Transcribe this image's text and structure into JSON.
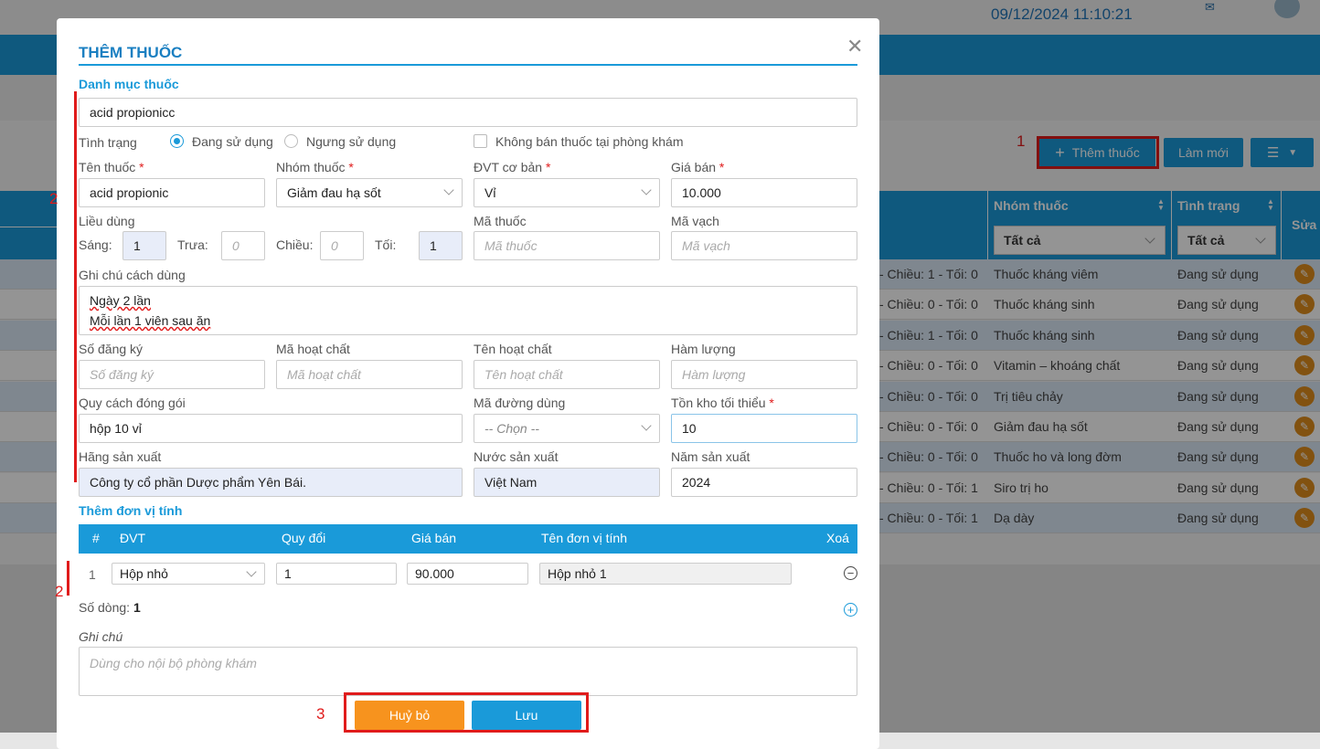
{
  "header": {
    "datetime": "09/12/2024 11:10:21"
  },
  "toolbar": {
    "add_label": "Thêm thuốc",
    "refresh_label": "Làm mới"
  },
  "table": {
    "col_group": "Nhóm thuốc",
    "col_status": "Tình trạng",
    "col_edit": "Sửa",
    "filter_group": "Tất cả",
    "filter_status": "Tất cả",
    "rows": [
      {
        "dose": "- Chiều: 1 - Tối: 0",
        "group": "Thuốc kháng viêm",
        "status": "Đang sử dụng"
      },
      {
        "dose": "- Chiều: 0 - Tối: 0",
        "group": "Thuốc kháng sinh",
        "status": "Đang sử dụng"
      },
      {
        "dose": "- Chiều: 1 - Tối: 0",
        "group": "Thuốc kháng sinh",
        "status": "Đang sử dụng"
      },
      {
        "dose": "- Chiều: 0 - Tối: 0",
        "group": "Vitamin – khoáng chất",
        "status": "Đang sử dụng"
      },
      {
        "dose": "- Chiều: 0 - Tối: 0",
        "group": "Trị tiêu chảy",
        "status": "Đang sử dụng"
      },
      {
        "dose": "- Chiều: 0 - Tối: 0",
        "group": "Giảm đau hạ sốt",
        "status": "Đang sử dụng"
      },
      {
        "dose": "- Chiều: 0 - Tối: 0",
        "group": "Thuốc ho và long đờm",
        "status": "Đang sử dụng"
      },
      {
        "dose": "- Chiều: 0 - Tối: 1",
        "group": "Siro trị ho",
        "status": "Đang sử dụng"
      },
      {
        "dose": "- Chiều: 0 - Tối: 1",
        "group": "Dạ dày",
        "status": "Đang sử dụng"
      }
    ]
  },
  "annotations": {
    "n1": "1",
    "n2a": "2",
    "n2b": "2",
    "n3": "3"
  },
  "modal": {
    "title": "THÊM THUỐC",
    "section_catalog": "Danh mục thuốc",
    "catalog_value": "acid propionicc",
    "status_label": "Tình trạng",
    "status_active": "Đang sử dụng",
    "status_inactive": "Ngưng sử dụng",
    "no_sale_label": "Không bán thuốc tại phòng khám",
    "name_label": "Tên thuốc",
    "name_value": "acid propionic",
    "group_label": "Nhóm thuốc",
    "group_value": "Giảm đau hạ sốt",
    "unit_label": "ĐVT cơ bản",
    "unit_value": "Vỉ",
    "price_label": "Giá bán",
    "price_value": "10.000",
    "dosage_label": "Liều dùng",
    "morning_label": "Sáng:",
    "morning_value": "1",
    "noon_label": "Trưa:",
    "noon_placeholder": "0",
    "afternoon_label": "Chiều:",
    "afternoon_placeholder": "0",
    "evening_label": "Tối:",
    "evening_value": "1",
    "code_label": "Mã thuốc",
    "code_placeholder": "Mã thuốc",
    "barcode_label": "Mã vạch",
    "barcode_placeholder": "Mã vạch",
    "usage_note_label": "Ghi chú cách dùng",
    "usage_line1": "Ngày 2 lần",
    "usage_line2": "Mỗi lần 1 viên sau ăn",
    "reg_label": "Số đăng ký",
    "reg_placeholder": "Số đăng ký",
    "active_code_label": "Mã hoạt chất",
    "active_code_placeholder": "Mã hoạt chất",
    "active_name_label": "Tên hoạt chất",
    "active_name_placeholder": "Tên hoạt chất",
    "strength_label": "Hàm lượng",
    "strength_placeholder": "Hàm lượng",
    "packing_label": "Quy cách đóng gói",
    "packing_value": "hộp 10 vỉ",
    "route_label": "Mã đường dùng",
    "route_value": "-- Chọn --",
    "min_stock_label": "Tồn kho tối thiểu",
    "min_stock_value": "10",
    "maker_label": "Hãng sản xuất",
    "maker_value": "Công ty cổ phần Dược phẩm Yên Bái.",
    "country_label": "Nước sản xuất",
    "country_value": "Việt Nam",
    "year_label": "Năm sản xuất",
    "year_value": "2024",
    "section_units": "Thêm đơn vị tính",
    "units_headers": {
      "num": "#",
      "unit": "ĐVT",
      "convert": "Quy đổi",
      "price": "Giá bán",
      "name": "Tên đơn vị tính",
      "delete": "Xoá"
    },
    "unit_row": {
      "num": "1",
      "unit": "Hộp nhỏ",
      "convert": "1",
      "price": "90.000",
      "name": "Hộp nhỏ 1"
    },
    "row_count_label": "Số dòng:",
    "row_count_value": "1",
    "note_label": "Ghi chú",
    "note_placeholder": "Dùng cho nội bộ phòng khám",
    "cancel_label": "Huỷ bỏ",
    "save_label": "Lưu"
  },
  "colors": {
    "primary": "#1a9ad9",
    "cancel": "#f7931e",
    "annotation": "#e01b1b"
  }
}
